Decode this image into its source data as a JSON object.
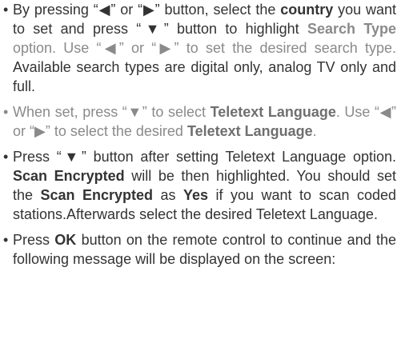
{
  "bullet_char": "•",
  "arrows": {
    "left": "◀",
    "right": "▶",
    "down": "▼"
  },
  "items": [
    {
      "segments": [
        {
          "t": "By pressing “"
        },
        {
          "arrow": "left"
        },
        {
          "t": "” or “"
        },
        {
          "arrow": "right"
        },
        {
          "t": "” button, select the "
        },
        {
          "t": "country",
          "b": true
        },
        {
          "t": " you want to set and press “"
        },
        {
          "arrow": "down"
        },
        {
          "t": "” button to highlight "
        },
        {
          "t": "Search Type",
          "b": true,
          "m": true
        },
        {
          "t": " option. Use “",
          "m": true
        },
        {
          "arrow": "left",
          "m": true
        },
        {
          "t": "” or “",
          "m": true
        },
        {
          "arrow": "right",
          "m": true
        },
        {
          "t": "” to set the desired search type.",
          "m": true
        },
        {
          "t": " Available search types are digital only, analog TV only and full."
        }
      ]
    },
    {
      "muted": true,
      "segments": [
        {
          "t": "When set, press “"
        },
        {
          "arrow": "down"
        },
        {
          "t": "” to select "
        },
        {
          "t": "Teletext Language",
          "b": true
        },
        {
          "t": ". Use “"
        },
        {
          "arrow": "left"
        },
        {
          "t": "” or “"
        },
        {
          "arrow": "right"
        },
        {
          "t": "” to select the desired "
        },
        {
          "t": "Teletext Language",
          "b": true
        },
        {
          "t": "."
        }
      ]
    },
    {
      "segments": [
        {
          "t": "Press “"
        },
        {
          "arrow": "down"
        },
        {
          "t": "” button after setting Teletext Language option. "
        },
        {
          "t": "Scan Encrypted",
          "b": true
        },
        {
          "t": " will be then highlighted. You should set the "
        },
        {
          "t": "Scan Encrypted",
          "b": true
        },
        {
          "t": " as "
        },
        {
          "t": "Yes",
          "b": true
        },
        {
          "t": " if you want to scan coded stations.Afterwards select the desired Teletext Language."
        }
      ]
    },
    {
      "segments": [
        {
          "t": "Press "
        },
        {
          "t": "OK",
          "b": true
        },
        {
          "t": " button on the remote control to continue and the following message will be displayed on the screen:"
        }
      ]
    }
  ]
}
